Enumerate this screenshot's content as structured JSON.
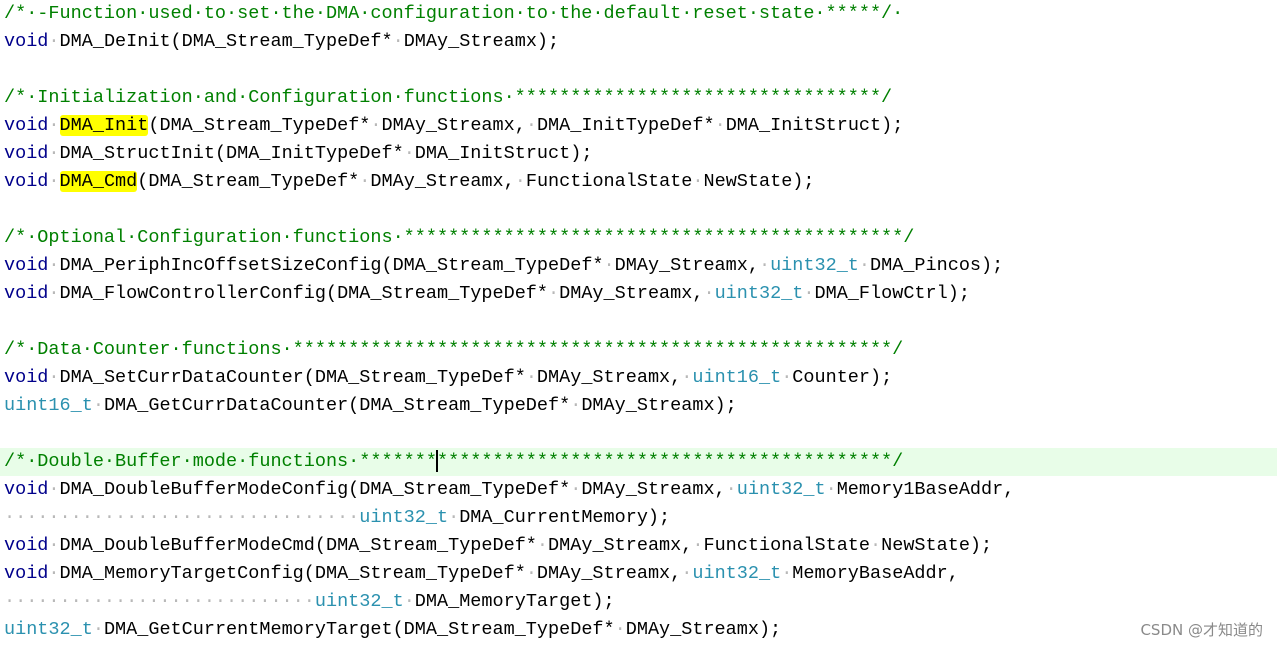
{
  "editor": {
    "lines": [
      {
        "tokens": [
          {
            "t": "/*·-Function·used·to·set·the·DMA·configuration·to·the·default·reset·state·*****/·",
            "c": "comment"
          }
        ]
      },
      {
        "tokens": [
          {
            "t": "void",
            "c": "keyword"
          },
          {
            "t": "·",
            "c": "ws"
          },
          {
            "t": "DMA_DeInit(DMA_Stream_TypeDef*",
            "c": "plain"
          },
          {
            "t": "·",
            "c": "ws"
          },
          {
            "t": "DMAy_Streamx);",
            "c": "plain"
          }
        ]
      },
      {
        "tokens": []
      },
      {
        "tokens": [
          {
            "t": "/*·Initialization·and·Configuration·functions·*********************************/",
            "c": "comment"
          }
        ]
      },
      {
        "tokens": [
          {
            "t": "void",
            "c": "keyword"
          },
          {
            "t": "·",
            "c": "ws"
          },
          {
            "t": "DMA_Init",
            "c": "plain",
            "hl": true
          },
          {
            "t": "(DMA_Stream_TypeDef*",
            "c": "plain"
          },
          {
            "t": "·",
            "c": "ws"
          },
          {
            "t": "DMAy_Streamx,",
            "c": "plain"
          },
          {
            "t": "·",
            "c": "ws"
          },
          {
            "t": "DMA_InitTypeDef*",
            "c": "plain"
          },
          {
            "t": "·",
            "c": "ws"
          },
          {
            "t": "DMA_InitStruct);",
            "c": "plain"
          }
        ]
      },
      {
        "tokens": [
          {
            "t": "void",
            "c": "keyword"
          },
          {
            "t": "·",
            "c": "ws"
          },
          {
            "t": "DMA_StructInit(DMA_InitTypeDef*",
            "c": "plain"
          },
          {
            "t": "·",
            "c": "ws"
          },
          {
            "t": "DMA_InitStruct);",
            "c": "plain"
          }
        ]
      },
      {
        "tokens": [
          {
            "t": "void",
            "c": "keyword"
          },
          {
            "t": "·",
            "c": "ws"
          },
          {
            "t": "DMA_Cmd",
            "c": "plain",
            "hl": true
          },
          {
            "t": "(DMA_Stream_TypeDef*",
            "c": "plain"
          },
          {
            "t": "·",
            "c": "ws"
          },
          {
            "t": "DMAy_Streamx,",
            "c": "plain"
          },
          {
            "t": "·",
            "c": "ws"
          },
          {
            "t": "FunctionalState",
            "c": "plain"
          },
          {
            "t": "·",
            "c": "ws"
          },
          {
            "t": "NewState);",
            "c": "plain"
          }
        ]
      },
      {
        "tokens": []
      },
      {
        "tokens": [
          {
            "t": "/*·Optional·Configuration·functions·*********************************************/",
            "c": "comment"
          }
        ]
      },
      {
        "tokens": [
          {
            "t": "void",
            "c": "keyword"
          },
          {
            "t": "·",
            "c": "ws"
          },
          {
            "t": "DMA_PeriphIncOffsetSizeConfig(DMA_Stream_TypeDef*",
            "c": "plain"
          },
          {
            "t": "·",
            "c": "ws"
          },
          {
            "t": "DMAy_Streamx,",
            "c": "plain"
          },
          {
            "t": "·",
            "c": "ws"
          },
          {
            "t": "uint32_t",
            "c": "type"
          },
          {
            "t": "·",
            "c": "ws"
          },
          {
            "t": "DMA_Pincos);",
            "c": "plain"
          }
        ]
      },
      {
        "tokens": [
          {
            "t": "void",
            "c": "keyword"
          },
          {
            "t": "·",
            "c": "ws"
          },
          {
            "t": "DMA_FlowControllerConfig(DMA_Stream_TypeDef*",
            "c": "plain"
          },
          {
            "t": "·",
            "c": "ws"
          },
          {
            "t": "DMAy_Streamx,",
            "c": "plain"
          },
          {
            "t": "·",
            "c": "ws"
          },
          {
            "t": "uint32_t",
            "c": "type"
          },
          {
            "t": "·",
            "c": "ws"
          },
          {
            "t": "DMA_FlowCtrl);",
            "c": "plain"
          }
        ]
      },
      {
        "tokens": []
      },
      {
        "tokens": [
          {
            "t": "/*·Data·Counter·functions·******************************************************/",
            "c": "comment"
          }
        ]
      },
      {
        "tokens": [
          {
            "t": "void",
            "c": "keyword"
          },
          {
            "t": "·",
            "c": "ws"
          },
          {
            "t": "DMA_SetCurrDataCounter(DMA_Stream_TypeDef*",
            "c": "plain"
          },
          {
            "t": "·",
            "c": "ws"
          },
          {
            "t": "DMAy_Streamx,",
            "c": "plain"
          },
          {
            "t": "·",
            "c": "ws"
          },
          {
            "t": "uint16_t",
            "c": "type"
          },
          {
            "t": "·",
            "c": "ws"
          },
          {
            "t": "Counter);",
            "c": "plain"
          }
        ]
      },
      {
        "tokens": [
          {
            "t": "uint16_t",
            "c": "type"
          },
          {
            "t": "·",
            "c": "ws"
          },
          {
            "t": "DMA_GetCurrDataCounter(DMA_Stream_TypeDef*",
            "c": "plain"
          },
          {
            "t": "·",
            "c": "ws"
          },
          {
            "t": "DMAy_Streamx);",
            "c": "plain"
          }
        ]
      },
      {
        "tokens": []
      },
      {
        "current": true,
        "tokens": [
          {
            "t": "/*·Double·Buffer·mode·functions·*******",
            "c": "comment"
          },
          {
            "caret": true
          },
          {
            "t": "*****************************************/",
            "c": "comment"
          }
        ]
      },
      {
        "tokens": [
          {
            "t": "void",
            "c": "keyword"
          },
          {
            "t": "·",
            "c": "ws"
          },
          {
            "t": "DMA_DoubleBufferModeConfig(DMA_Stream_TypeDef*",
            "c": "plain"
          },
          {
            "t": "·",
            "c": "ws"
          },
          {
            "t": "DMAy_Streamx,",
            "c": "plain"
          },
          {
            "t": "·",
            "c": "ws"
          },
          {
            "t": "uint32_t",
            "c": "type"
          },
          {
            "t": "·",
            "c": "ws"
          },
          {
            "t": "Memory1BaseAddr,",
            "c": "plain"
          }
        ]
      },
      {
        "tokens": [
          {
            "t": "································",
            "c": "ws"
          },
          {
            "t": "uint32_t",
            "c": "type"
          },
          {
            "t": "·",
            "c": "ws"
          },
          {
            "t": "DMA_CurrentMemory);",
            "c": "plain"
          }
        ]
      },
      {
        "tokens": [
          {
            "t": "void",
            "c": "keyword"
          },
          {
            "t": "·",
            "c": "ws"
          },
          {
            "t": "DMA_DoubleBufferModeCmd(DMA_Stream_TypeDef*",
            "c": "plain"
          },
          {
            "t": "·",
            "c": "ws"
          },
          {
            "t": "DMAy_Streamx,",
            "c": "plain"
          },
          {
            "t": "·",
            "c": "ws"
          },
          {
            "t": "FunctionalState",
            "c": "plain"
          },
          {
            "t": "·",
            "c": "ws"
          },
          {
            "t": "NewState);",
            "c": "plain"
          }
        ]
      },
      {
        "tokens": [
          {
            "t": "void",
            "c": "keyword"
          },
          {
            "t": "·",
            "c": "ws"
          },
          {
            "t": "DMA_MemoryTargetConfig(DMA_Stream_TypeDef*",
            "c": "plain"
          },
          {
            "t": "·",
            "c": "ws"
          },
          {
            "t": "DMAy_Streamx,",
            "c": "plain"
          },
          {
            "t": "·",
            "c": "ws"
          },
          {
            "t": "uint32_t",
            "c": "type"
          },
          {
            "t": "·",
            "c": "ws"
          },
          {
            "t": "MemoryBaseAddr,",
            "c": "plain"
          }
        ]
      },
      {
        "tokens": [
          {
            "t": "····························",
            "c": "ws"
          },
          {
            "t": "uint32_t",
            "c": "type"
          },
          {
            "t": "·",
            "c": "ws"
          },
          {
            "t": "DMA_MemoryTarget);",
            "c": "plain"
          }
        ]
      },
      {
        "tokens": [
          {
            "t": "uint32_t",
            "c": "type"
          },
          {
            "t": "·",
            "c": "ws"
          },
          {
            "t": "DMA_GetCurrentMemoryTarget(DMA_Stream_TypeDef*",
            "c": "plain"
          },
          {
            "t": "·",
            "c": "ws"
          },
          {
            "t": "DMAy_Streamx);",
            "c": "plain"
          }
        ]
      }
    ]
  },
  "watermark": "CSDN @才知道的",
  "colors": {
    "comment": "#008000",
    "keyword": "#00008b",
    "type": "#2b91af",
    "highlight": "#ffff00",
    "current_line": "#e8fde8"
  }
}
